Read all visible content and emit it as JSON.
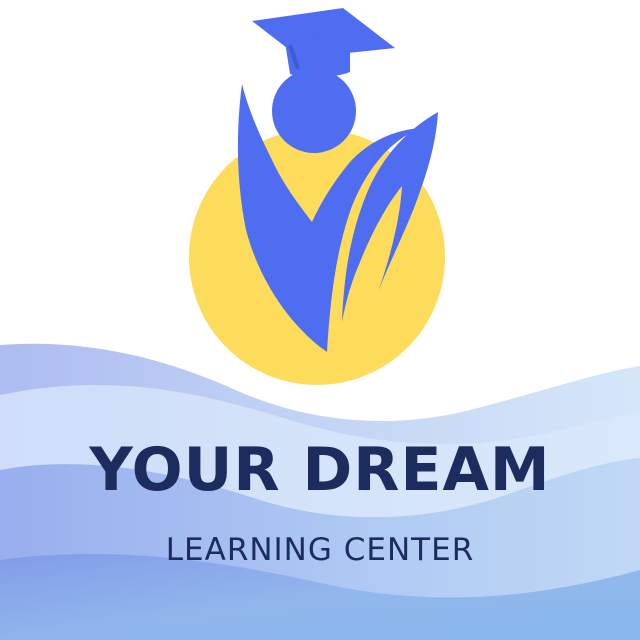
{
  "logo": {
    "name": "YOUR DREAM",
    "tagline": "LEARNING CENTER",
    "icon": "graduate-with-cap-icon",
    "colors": {
      "figure": "#4f6df0",
      "sun": "#fddc5c",
      "text": "#1d2c5e",
      "wave_light": "#d6e7fa",
      "wave_mid": "#b3d1f4",
      "wave_deep": "#8fb5ec"
    }
  }
}
